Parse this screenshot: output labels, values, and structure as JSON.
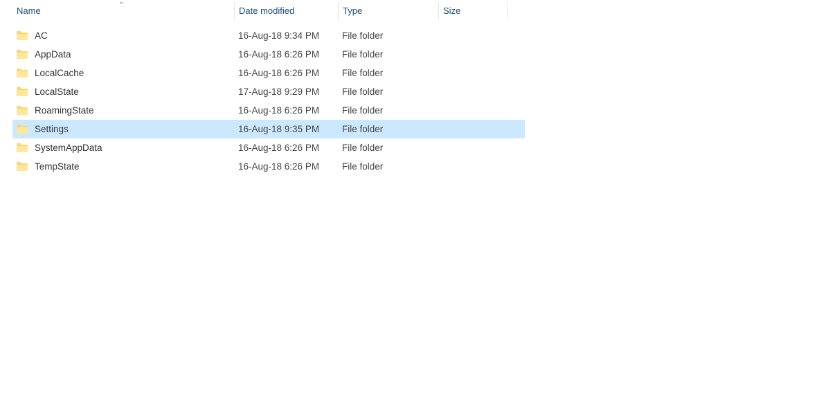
{
  "columns": {
    "name": "Name",
    "date": "Date modified",
    "type": "Type",
    "size": "Size"
  },
  "sort_indicator": "^",
  "items": [
    {
      "name": "AC",
      "date": "16-Aug-18 9:34 PM",
      "type": "File folder",
      "size": "",
      "selected": false
    },
    {
      "name": "AppData",
      "date": "16-Aug-18 6:26 PM",
      "type": "File folder",
      "size": "",
      "selected": false
    },
    {
      "name": "LocalCache",
      "date": "16-Aug-18 6:26 PM",
      "type": "File folder",
      "size": "",
      "selected": false
    },
    {
      "name": "LocalState",
      "date": "17-Aug-18 9:29 PM",
      "type": "File folder",
      "size": "",
      "selected": false
    },
    {
      "name": "RoamingState",
      "date": "16-Aug-18 6:26 PM",
      "type": "File folder",
      "size": "",
      "selected": false
    },
    {
      "name": "Settings",
      "date": "16-Aug-18 9:35 PM",
      "type": "File folder",
      "size": "",
      "selected": true
    },
    {
      "name": "SystemAppData",
      "date": "16-Aug-18 6:26 PM",
      "type": "File folder",
      "size": "",
      "selected": false
    },
    {
      "name": "TempState",
      "date": "16-Aug-18 6:26 PM",
      "type": "File folder",
      "size": "",
      "selected": false
    }
  ]
}
